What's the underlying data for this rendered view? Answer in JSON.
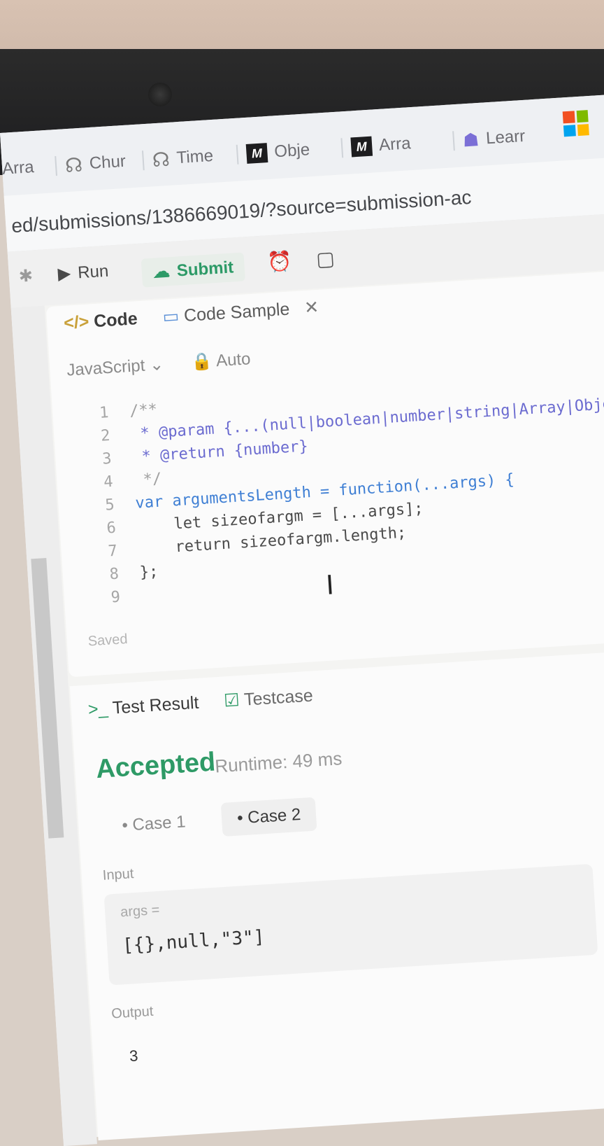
{
  "tabs": [
    {
      "label": "Arra",
      "icon": "leetcode-icon"
    },
    {
      "label": "Chur",
      "icon": "leetcode-icon"
    },
    {
      "label": "Time",
      "icon": "leetcode-icon"
    },
    {
      "label": "Obje",
      "icon": "m-icon"
    },
    {
      "label": "Arra",
      "icon": "m-icon"
    },
    {
      "label": "Learr",
      "icon": "learn-icon"
    }
  ],
  "address": "ed/submissions/1386669019/?source=submission-ac",
  "toolbar": {
    "run_label": "Run",
    "submit_label": "Submit"
  },
  "editor": {
    "tab_code": "Code",
    "tab_sample": "Code Sample",
    "language": "JavaScript",
    "auto_label": "Auto",
    "saved_label": "Saved",
    "lines": [
      {
        "n": "1",
        "t": "/**"
      },
      {
        "n": "2",
        "t": " * @param {...(null|boolean|number|string|Array|Object"
      },
      {
        "n": "3",
        "t": " * @return {number}"
      },
      {
        "n": "4",
        "t": " */"
      },
      {
        "n": "5",
        "t": "var argumentsLength = function(...args) {"
      },
      {
        "n": "6",
        "t": "    let sizeofargm = [...args];"
      },
      {
        "n": "7",
        "t": "    return sizeofargm.length;"
      },
      {
        "n": "8",
        "t": "};"
      },
      {
        "n": "9",
        "t": ""
      }
    ]
  },
  "results": {
    "tab_result": "Test Result",
    "tab_testcase": "Testcase",
    "status": "Accepted",
    "runtime": "Runtime: 49 ms",
    "cases": [
      "Case 1",
      "Case 2"
    ],
    "input_label": "Input",
    "arg_name": "args =",
    "arg_value": "[{},null,\"3\"]",
    "output_label": "Output",
    "output_value": "3"
  },
  "colors": {
    "accepted": "#2e9a66",
    "keyword": "#3f7fd4",
    "param_tag": "#6b6bd0"
  }
}
